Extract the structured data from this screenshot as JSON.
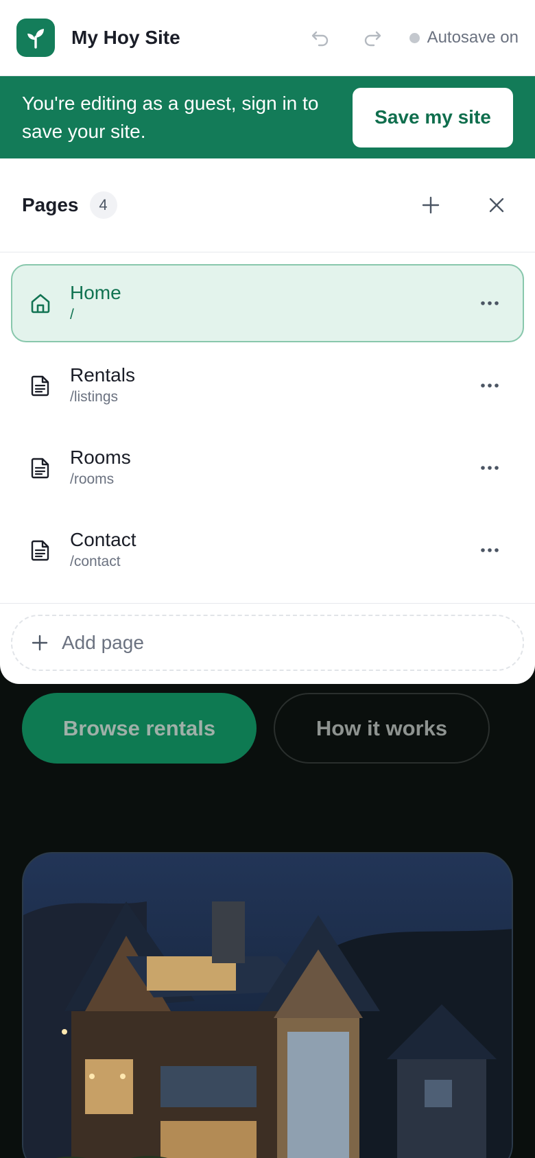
{
  "header": {
    "site_title": "My Hoy Site",
    "autosave_label": "Autosave on",
    "icons": [
      "sprout-icon",
      "undo-icon",
      "redo-icon"
    ]
  },
  "banner": {
    "message": "You're editing as a guest, sign in to save your site.",
    "save_button": "Save my site"
  },
  "pages_panel": {
    "title": "Pages",
    "count": "4",
    "pages": [
      {
        "name": "Home",
        "path": "/",
        "icon": "home-icon",
        "active": true
      },
      {
        "name": "Rentals",
        "path": "/listings",
        "icon": "document-icon",
        "active": false
      },
      {
        "name": "Rooms",
        "path": "/rooms",
        "icon": "document-icon",
        "active": false
      },
      {
        "name": "Contact",
        "path": "/contact",
        "icon": "document-icon",
        "active": false
      }
    ],
    "add_page_label": "Add page"
  },
  "site_preview": {
    "primary_cta": "Browse rentals",
    "secondary_cta": "How it works"
  },
  "colors": {
    "brand": "#147d5a",
    "active_bg": "#e3f3ec",
    "active_text": "#117352"
  }
}
